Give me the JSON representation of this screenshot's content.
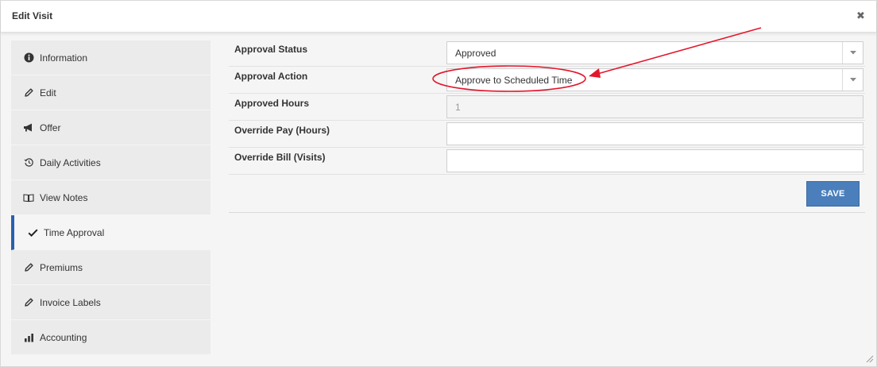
{
  "dialog": {
    "title": "Edit Visit",
    "close_glyph": "✖"
  },
  "sidebar": {
    "items": [
      {
        "label": "Information",
        "icon": "info-circle-icon"
      },
      {
        "label": "Edit",
        "icon": "pencil-icon"
      },
      {
        "label": "Offer",
        "icon": "megaphone-icon"
      },
      {
        "label": "Daily Activities",
        "icon": "history-icon"
      },
      {
        "label": "View Notes",
        "icon": "book-icon"
      },
      {
        "label": "Time Approval",
        "icon": "check-icon",
        "active": true
      },
      {
        "label": "Premiums",
        "icon": "pencil-icon"
      },
      {
        "label": "Invoice Labels",
        "icon": "pencil-icon"
      },
      {
        "label": "Accounting",
        "icon": "bar-chart-icon"
      }
    ]
  },
  "form": {
    "approval_status": {
      "label": "Approval Status",
      "value": "Approved"
    },
    "approval_action": {
      "label": "Approval Action",
      "value": "Approve to Scheduled Time"
    },
    "approved_hours": {
      "label": "Approved Hours",
      "value": "1"
    },
    "override_pay": {
      "label": "Override Pay (Hours)",
      "value": ""
    },
    "override_bill": {
      "label": "Override Bill (Visits)",
      "value": ""
    },
    "save_label": "SAVE"
  },
  "colors": {
    "accent": "#2a5fb0",
    "save_button": "#4a7fbb",
    "annotation": "#e3162b"
  }
}
